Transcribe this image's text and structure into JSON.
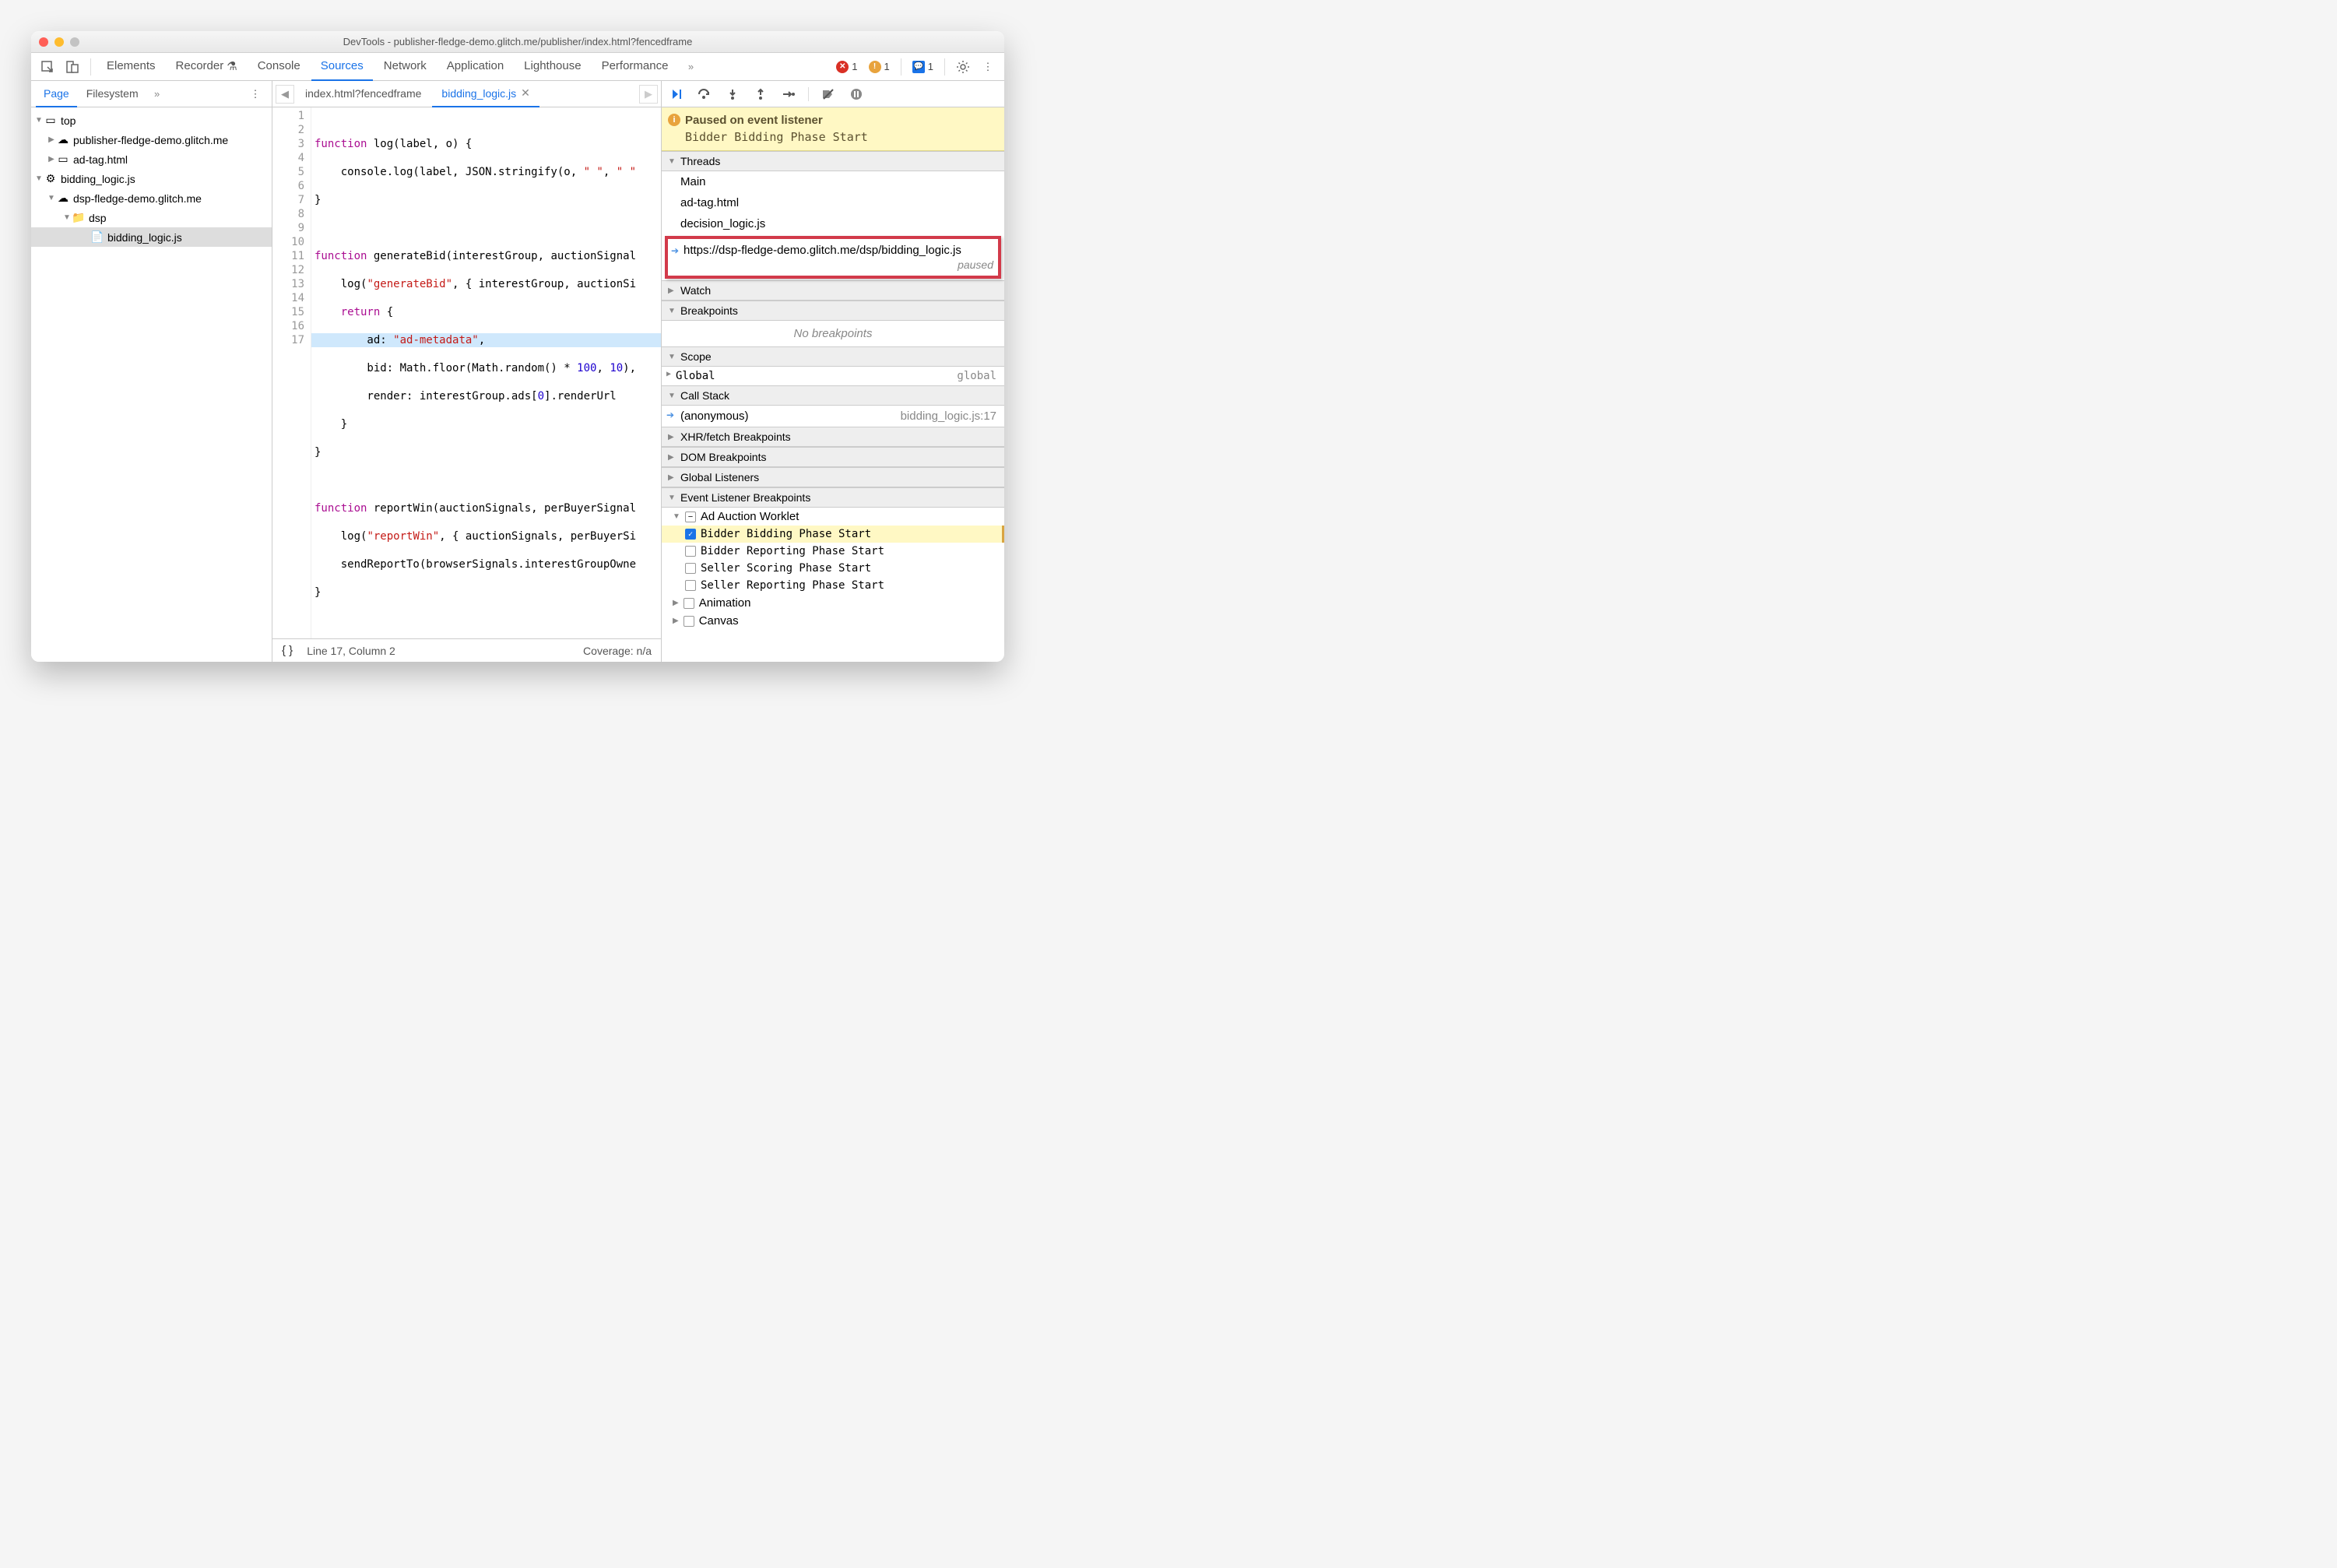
{
  "window": {
    "title": "DevTools - publisher-fledge-demo.glitch.me/publisher/index.html?fencedframe"
  },
  "main_tabs": [
    "Elements",
    "Recorder",
    "Console",
    "Sources",
    "Network",
    "Application",
    "Lighthouse",
    "Performance"
  ],
  "main_tabs_active": "Sources",
  "badges": {
    "errors": "1",
    "warnings": "1",
    "issues": "1"
  },
  "left_tabs": {
    "page": "Page",
    "filesystem": "Filesystem"
  },
  "tree": {
    "top": "top",
    "pub": "publisher-fledge-demo.glitch.me",
    "adtag": "ad-tag.html",
    "bidding_ctx": "bidding_logic.js",
    "dsp_host": "dsp-fledge-demo.glitch.me",
    "dsp_folder": "dsp",
    "bidding_file": "bidding_logic.js"
  },
  "file_tabs": {
    "t1": "index.html?fencedframe",
    "t2": "bidding_logic.js"
  },
  "code": {
    "lines": 17,
    "l1a": "function",
    "l1b": " log(label, o) {",
    "l2a": "    console.log(label, JSON.stringify(o, ",
    "l2b": "\" \"",
    "l2c": ", ",
    "l2d": "\" \"",
    "l3": "}",
    "l5a": "function",
    "l5b": " generateBid(interestGroup, auctionSignal",
    "l6a": "    log(",
    "l6b": "\"generateBid\"",
    "l6c": ", { interestGroup, auctionSi",
    "l7a": "    ",
    "l7b": "return",
    "l7c": " {",
    "l8a": "        ad: ",
    "l8b": "\"ad-metadata\"",
    "l8c": ",",
    "l9a": "        bid: Math.floor(Math.random() * ",
    "l9b": "100",
    "l9c": ", ",
    "l9d": "10",
    "l9e": "),",
    "l10": "        render: interestGroup.ads[",
    "l10b": "0",
    "l10c": "].renderUrl",
    "l11": "    }",
    "l12": "}",
    "l14a": "function",
    "l14b": " reportWin(auctionSignals, perBuyerSignal",
    "l15a": "    log(",
    "l15b": "\"reportWin\"",
    "l15c": ", { auctionSignals, perBuyerSi",
    "l16": "    sendReportTo(browserSignals.interestGroupOwne",
    "l17": "}"
  },
  "status": {
    "pos": "Line 17, Column 2",
    "coverage": "Coverage: n/a"
  },
  "debugger": {
    "paused_title": "Paused on event listener",
    "paused_sub": "Bidder Bidding Phase Start",
    "threads_hdr": "Threads",
    "threads": [
      "Main",
      "ad-tag.html",
      "decision_logic.js"
    ],
    "thread_active": "https://dsp-fledge-demo.glitch.me/dsp/bidding_logic.js",
    "thread_paused": "paused",
    "watch": "Watch",
    "breakpoints": "Breakpoints",
    "no_bp": "No breakpoints",
    "scope": "Scope",
    "scope_global": "Global",
    "scope_global_val": "global",
    "callstack": "Call Stack",
    "call_fn": "(anonymous)",
    "call_loc": "bidding_logic.js:17",
    "xhr": "XHR/fetch Breakpoints",
    "dom": "DOM Breakpoints",
    "global_listeners": "Global Listeners",
    "evt_hdr": "Event Listener Breakpoints",
    "evt_cat": "Ad Auction Worklet",
    "evt_items": [
      {
        "label": "Bidder Bidding Phase Start",
        "checked": true,
        "hit": true
      },
      {
        "label": "Bidder Reporting Phase Start",
        "checked": false,
        "hit": false
      },
      {
        "label": "Seller Scoring Phase Start",
        "checked": false,
        "hit": false
      },
      {
        "label": "Seller Reporting Phase Start",
        "checked": false,
        "hit": false
      }
    ],
    "animation": "Animation",
    "canvas": "Canvas"
  }
}
